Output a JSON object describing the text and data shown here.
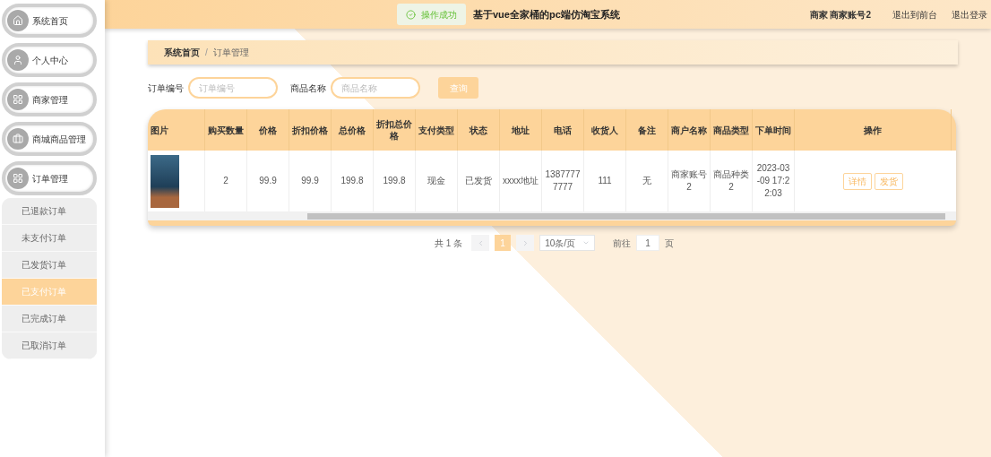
{
  "sidebar": {
    "items": [
      {
        "label": "系统首页"
      },
      {
        "label": "个人中心"
      },
      {
        "label": "商家管理"
      },
      {
        "label": "商城商品管理"
      },
      {
        "label": "订单管理",
        "children": [
          {
            "label": "已退款订单",
            "selected": false
          },
          {
            "label": "未支付订单",
            "selected": false
          },
          {
            "label": "已发货订单",
            "selected": false
          },
          {
            "label": "已支付订单",
            "selected": true
          },
          {
            "label": "已完成订单",
            "selected": false
          },
          {
            "label": "已取消订单",
            "selected": false
          }
        ]
      }
    ]
  },
  "header": {
    "toast": "操作成功",
    "title": "基于vue全家桶的pc端仿淘宝系统",
    "user": "商家 商家账号2",
    "links": [
      "退出到前台",
      "退出登录"
    ]
  },
  "breadcrumb": {
    "items": [
      "系统首页",
      "订单管理"
    ],
    "separator": "/"
  },
  "search": {
    "fields": [
      {
        "label": "订单编号",
        "placeholder": "订单编号"
      },
      {
        "label": "商品名称",
        "placeholder": "商品名称"
      }
    ],
    "button": "查询"
  },
  "table": {
    "columns": [
      "图片",
      "购买数量",
      "价格",
      "折扣价格",
      "总价格",
      "折扣总价格",
      "支付类型",
      "状态",
      "地址",
      "电话",
      "收货人",
      "备注",
      "商户名称",
      "商品类型",
      "下单时间",
      "操作"
    ],
    "rows": [
      {
        "cells": [
          {
            "kind": "image"
          },
          {
            "kind": "text",
            "text": "2"
          },
          {
            "kind": "text",
            "text": "99.9"
          },
          {
            "kind": "text",
            "text": "99.9"
          },
          {
            "kind": "text",
            "text": "199.8"
          },
          {
            "kind": "text",
            "text": "199.8"
          },
          {
            "kind": "text",
            "text": "现金"
          },
          {
            "kind": "text",
            "text": "已发货"
          },
          {
            "kind": "text",
            "text": "xxxx地址"
          },
          {
            "kind": "text",
            "text": "13877777777"
          },
          {
            "kind": "text",
            "text": "111"
          },
          {
            "kind": "text",
            "text": "无"
          },
          {
            "kind": "text",
            "text": "商家账号2"
          },
          {
            "kind": "text",
            "text": "商品种类2"
          },
          {
            "kind": "text",
            "text": "2023-03-09 17:22:03"
          },
          {
            "kind": "actions",
            "buttons": [
              "详情",
              "发货"
            ]
          }
        ]
      }
    ]
  },
  "pagination": {
    "total": "共 1 条",
    "pages": [
      {
        "label": "1",
        "selected": true
      }
    ],
    "page_size": "10条/页",
    "goto_label": "前往",
    "goto_value": "1",
    "page_unit": "页"
  }
}
